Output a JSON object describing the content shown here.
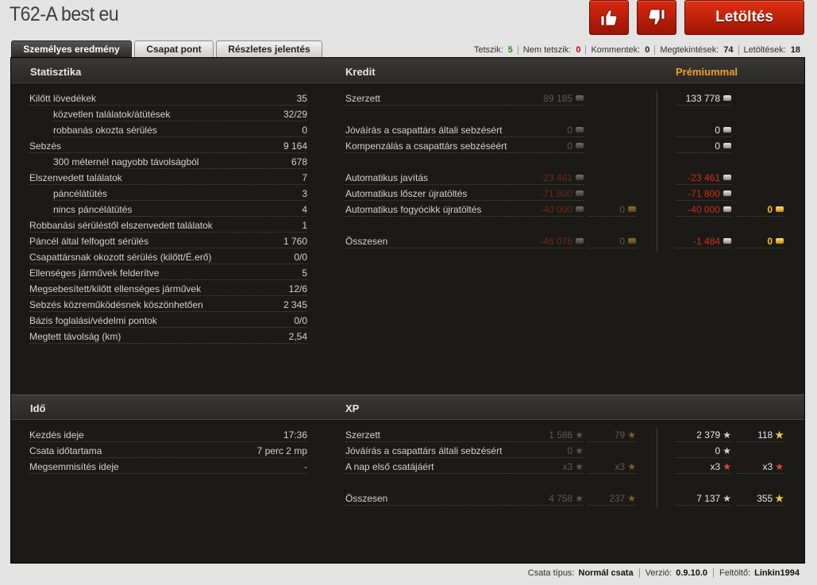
{
  "title": "T62-A best eu",
  "download_label": "Letöltés",
  "tabs": [
    "Személyes eredmény",
    "Csapat pont",
    "Részletes jelentés"
  ],
  "meta": {
    "likes_label": "Tetszik:",
    "likes": "5",
    "dislikes_label": "Nem tetszik:",
    "dislikes": "0",
    "comments_label": "Kommentek:",
    "comments": "0",
    "views_label": "Megtekintések:",
    "views": "74",
    "downloads_label": "Letöltések:",
    "downloads": "18"
  },
  "stats": {
    "heading": "Statisztika",
    "rows": [
      {
        "label": "Kilőtt lövedékek",
        "value": "35",
        "indent": false
      },
      {
        "label": "közvetlen találatok/átütések",
        "value": "32/29",
        "indent": true
      },
      {
        "label": "robbanás okozta sérülés",
        "value": "0",
        "indent": true
      },
      {
        "label": "Sebzés",
        "value": "9 164",
        "indent": false
      },
      {
        "label": "300 méternél nagyobb távolságból",
        "value": "678",
        "indent": true
      },
      {
        "label": "Elszenvedett találatok",
        "value": "7",
        "indent": false
      },
      {
        "label": "páncélátütés",
        "value": "3",
        "indent": true
      },
      {
        "label": "nincs páncélátütés",
        "value": "4",
        "indent": true
      },
      {
        "label": "Robbanási sérüléstől elszenvedett találatok",
        "value": "1",
        "indent": false
      },
      {
        "label": "Páncél által felfogott sérülés",
        "value": "1 760",
        "indent": false
      },
      {
        "label": "Csapattársnak okozott sérülés (kilőtt/É.erő)",
        "value": "0/0",
        "indent": false
      },
      {
        "label": "Ellenséges járművek felderítve",
        "value": "5",
        "indent": false
      },
      {
        "label": "Megsebesített/kilőtt ellenséges járművek",
        "value": "12/6",
        "indent": false
      },
      {
        "label": "Sebzés közreműködésnek köszönhetően",
        "value": "2 345",
        "indent": false
      },
      {
        "label": "Bázis foglalási/védelmi pontok",
        "value": "0/0",
        "indent": false
      },
      {
        "label": "Megtett távolság (km)",
        "value": "2,54",
        "indent": false
      }
    ]
  },
  "credit": {
    "heading": "Kredit",
    "premium_heading": "Prémiummal",
    "rows": [
      {
        "label": "Szerzett",
        "base_silver": "89 185",
        "base_gold": "",
        "prem_silver": "133 778",
        "prem_gold": "",
        "neg": false
      },
      {
        "label": "Jóváírás a csapattárs általi sebzésért",
        "base_silver": "0",
        "base_gold": "",
        "prem_silver": "0",
        "prem_gold": "",
        "neg": false
      },
      {
        "label": "Kompenzálás a csapattárs sebzéséért",
        "base_silver": "0",
        "base_gold": "",
        "prem_silver": "0",
        "prem_gold": "",
        "neg": false
      },
      {
        "label": "Automatikus javítás",
        "base_silver": "-23 461",
        "base_gold": "",
        "prem_silver": "-23 461",
        "prem_gold": "",
        "neg": true
      },
      {
        "label": "Automatikus lőszer újratöltés",
        "base_silver": "-71 800",
        "base_gold": "",
        "prem_silver": "-71 800",
        "prem_gold": "",
        "neg": true
      },
      {
        "label": "Automatikus fogyócikk újratöltés",
        "base_silver": "-40 000",
        "base_gold": "0",
        "prem_silver": "-40 000",
        "prem_gold": "0",
        "neg": true
      },
      {
        "label": "Összesen",
        "base_silver": "-46 076",
        "base_gold": "0",
        "prem_silver": "-1 484",
        "prem_gold": "0",
        "neg": true
      }
    ]
  },
  "time": {
    "heading": "Idő",
    "rows": [
      {
        "label": "Kezdés ideje",
        "value": "17:36"
      },
      {
        "label": "Csata időtartama",
        "value": "7 perc 2 mp"
      },
      {
        "label": "Megsemmisítés ideje",
        "value": "-"
      }
    ]
  },
  "xp": {
    "heading": "XP",
    "rows": [
      {
        "label": "Szerzett",
        "base_xp": "1 586",
        "base_free": "79",
        "prem_xp": "2 379",
        "prem_free": "118"
      },
      {
        "label": "Jóváírás a csapattárs általi sebzésért",
        "base_xp": "0",
        "base_free": "",
        "prem_xp": "0",
        "prem_free": ""
      },
      {
        "label": "A nap első csatájáért",
        "base_xp": "x3",
        "base_free": "x3",
        "prem_xp": "x3",
        "prem_free": "x3"
      },
      {
        "label": "Összesen",
        "base_xp": "4 758",
        "base_free": "237",
        "prem_xp": "7 137",
        "prem_free": "355"
      }
    ]
  },
  "footer": {
    "type_label": "Csata típus:",
    "type": "Normál csata",
    "version_label": "Verzió:",
    "version": "0.9.10.0",
    "uploader_label": "Feltöltő:",
    "uploader": "Linkin1994"
  }
}
